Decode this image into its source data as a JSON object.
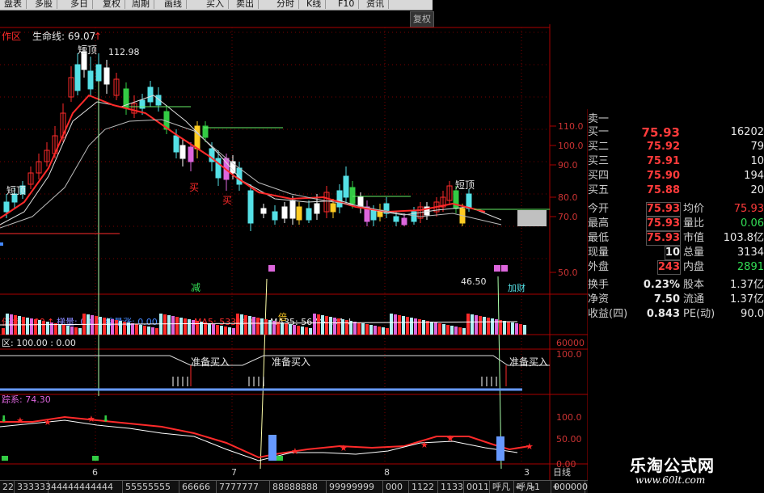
{
  "toolbar": {
    "items": [
      "盘表",
      "多股",
      "多日",
      "复权",
      "周期",
      "画线",
      "买入",
      "卖出",
      "分时",
      "K线",
      "F10",
      "资讯"
    ]
  },
  "restore_button": "复权",
  "main_chart": {
    "title": "作区",
    "lifeline_label": "生命线: 69.07",
    "lifeline_arrow": "↑",
    "high_marker": "112.98",
    "annotations": [
      "短顶",
      "短顶",
      "短顶",
      "买",
      "买",
      "减"
    ],
    "axis_ticks": [
      "110.0",
      "100.0",
      "90.0",
      "80.0",
      "70.0",
      "50.0"
    ]
  },
  "volume_pane": {
    "label1": "倍缩: 1.00",
    "arrow1": "↑",
    "label2": "梯量: 0.00",
    "label3": "缩量涨: 0.00",
    "ma5": "MA5: 53316.80",
    "ma35": "MA35: 56744.34",
    "arrow2": "↓",
    "marker": "46.50",
    "badge": "加财",
    "tick": "60000",
    "bei": "倍"
  },
  "signal_pane": {
    "label": "区: 100.00 : 0.00",
    "signals": [
      "准备买入",
      "准备买入",
      "准备买入"
    ],
    "tick": "100.0"
  },
  "osc_pane": {
    "label": "踪系: 74.30",
    "ticks": [
      "100.0",
      "50.00",
      "0.00"
    ]
  },
  "date_labels": [
    "6",
    "7",
    "8",
    "3"
  ],
  "quote": {
    "sell1": {
      "label": "卖一",
      "price": "",
      "vol": ""
    },
    "buy_rows": [
      {
        "label": "买一",
        "price": "75.93",
        "vol": "16202"
      },
      {
        "label": "买二",
        "price": "75.92",
        "vol": "79"
      },
      {
        "label": "买三",
        "price": "75.91",
        "vol": "10"
      },
      {
        "label": "买四",
        "price": "75.90",
        "vol": "194"
      },
      {
        "label": "买五",
        "price": "75.88",
        "vol": "20"
      }
    ],
    "stats": [
      {
        "l1": "今开",
        "v1": "75.93",
        "l2": "均价",
        "v2": "75.93"
      },
      {
        "l1": "最高",
        "v1": "75.93",
        "l2": "量比",
        "v2": "0.06"
      },
      {
        "l1": "最低",
        "v1": "75.93",
        "l2": "市值",
        "v2": "103.8亿"
      },
      {
        "l1": "现量",
        "v1": "10",
        "l2": "总量",
        "v2": "3134"
      },
      {
        "l1": "外盘",
        "v1": "243",
        "l2": "内盘",
        "v2": "2891"
      },
      {
        "l1": "换手",
        "v1": "0.23%",
        "l2": "股本",
        "v2": "1.37亿"
      },
      {
        "l1": "净资",
        "v1": "7.50",
        "l2": "流通",
        "v2": "1.37亿"
      },
      {
        "l1": "收益(四)",
        "v1": "0.843",
        "l2": "PE(动)",
        "v2": "90.0"
      }
    ]
  },
  "period_label": "日线",
  "bottom_tabs": [
    "22",
    "333333",
    "44444444444",
    "55555555",
    "66666",
    "7777777",
    "88888888",
    "99999999",
    "000",
    "1122",
    "1133",
    "0011",
    "呼凡",
    "呼凡1",
    "000000"
  ],
  "bottom_nav": [
    "<",
    ">",
    "+",
    "-"
  ],
  "watermark": {
    "cn": "乐淘公式网",
    "url": "www.60lt.com"
  },
  "colors": {
    "up": "#ff2a2a",
    "down": "#55e0e6",
    "bg": "#000000",
    "grid": "#8b0000"
  }
}
